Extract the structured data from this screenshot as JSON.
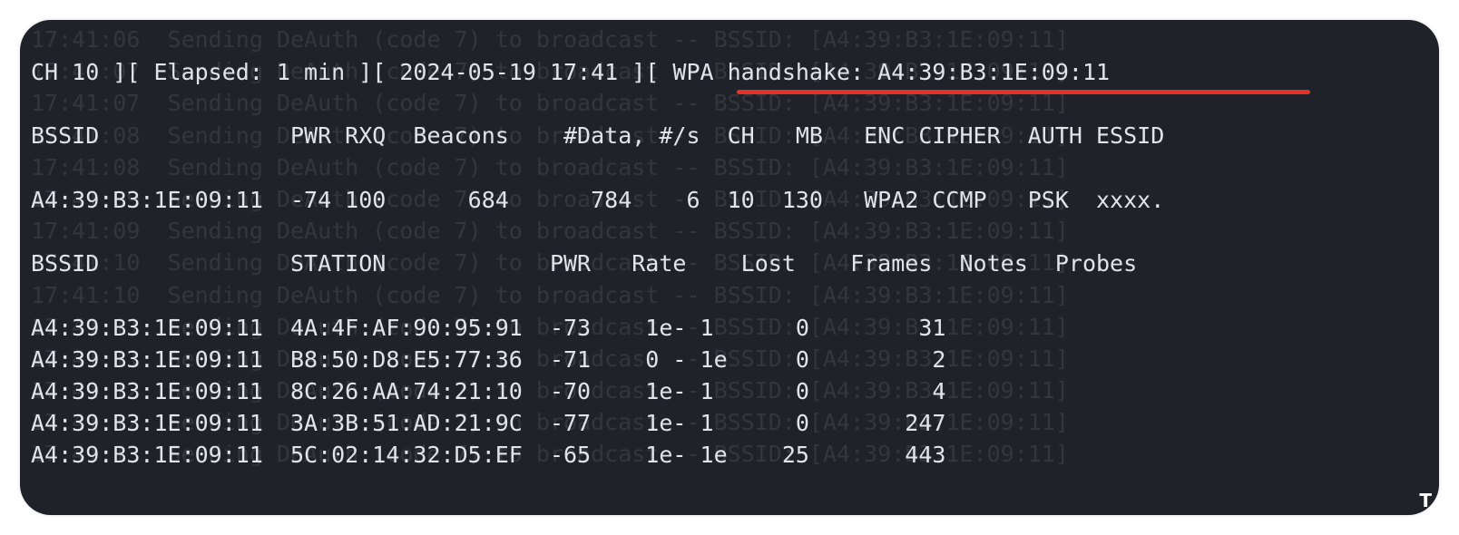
{
  "background_log": [
    "17:41:06  Sending DeAuth (code 7) to broadcast -- BSSID: [A4:39:B3:1E:09:11]",
    "17:41:07  Sending DeAuth (code 7) to broadcast -- BSSID: [A4:39:B3:1E:09:11]",
    "17:41:07  Sending DeAuth (code 7) to broadcast -- BSSID: [A4:39:B3:1E:09:11]",
    "17:41:08  Sending DeAuth (code 7) to broadcast -- BSSID: [A4:39:B3:1E:09:11]",
    "17:41:08  Sending DeAuth (code 7) to broadcast -- BSSID: [A4:39:B3:1E:09:11]",
    "17:41:09  Sending DeAuth (code 7) to broadcast -- BSSID: [A4:39:B3:1E:09:11]",
    "17:41:09  Sending DeAuth (code 7) to broadcast -- BSSID: [A4:39:B3:1E:09:11]",
    "17:41:10  Sending DeAuth (code 7) to broadcast -- BSSID: [A4:39:B3:1E:09:11]",
    "17:41:10  Sending DeAuth (code 7) to broadcast -- BSSID: [A4:39:B3:1E:09:11]",
    "17:41:11  Sending DeAuth (code 7) to broadcast -- BSSID: [A4:39:B3:1E:09:11]",
    "17:41:11  Sending DeAuth (code 7) to broadcast -- BSSID: [A4:39:B3:1E:09:11]",
    "17:41:12  Sending DeAuth (code 7) to broadcast -- BSSID: [A4:39:B3:1E:09:11]",
    "17:41:12  Sending DeAuth (code 7) to broadcast -- BSSID: [A4:39:B3:1E:09:11]",
    "17:41:13  Sending DeAuth (code 7) to broadcast -- BSSID: [A4:39:B3:1E:09:11]"
  ],
  "status_line": "CH 10 ][ Elapsed: 1 min ][ 2024-05-19 17:41 ][ WPA handshake: A4:39:B3:1E:09:11",
  "ap_header": "BSSID              PWR RXQ  Beacons    #Data, #/s  CH   MB   ENC CIPHER  AUTH ESSID",
  "ap_rows": [
    "A4:39:B3:1E:09:11  -74 100      684      784    6  10  130   WPA2 CCMP   PSK  xxxx."
  ],
  "station_header": "BSSID              STATION            PWR   Rate    Lost    Frames  Notes  Probes",
  "station_rows": [
    "A4:39:B3:1E:09:11  4A:4F:AF:90:95:91  -73    1e- 1      0        31",
    "A4:39:B3:1E:09:11  B8:50:D8:E5:77:36  -71    0 - 1e     0         2",
    "A4:39:B3:1E:09:11  8C:26:AA:74:21:10  -70    1e- 1      0         4",
    "A4:39:B3:1E:09:11  3A:3B:51:AD:21:9C  -77    1e- 1      0       247",
    "A4:39:B3:1E:09:11  5C:02:14:32:D5:EF  -65    1e- 1e    25       443"
  ],
  "watermark": "T",
  "colors": {
    "terminal_bg": "#20222a",
    "text": "#e2e4e8",
    "faded_log": "#34363f",
    "highlight_underline": "#e53226"
  }
}
